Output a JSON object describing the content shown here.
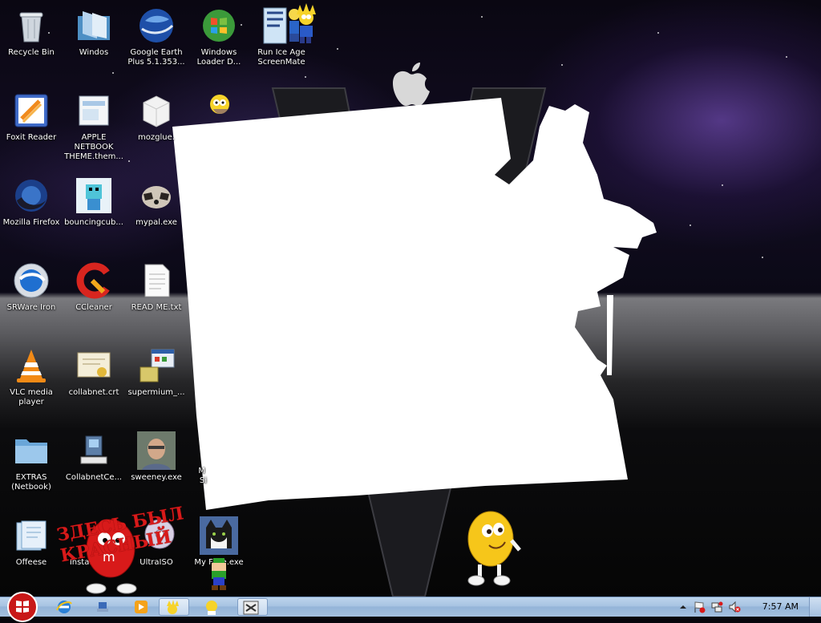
{
  "desktop": {
    "icons": [
      {
        "label": "Recycle Bin",
        "icon": "recycle-bin-icon"
      },
      {
        "label": "Windos",
        "icon": "folder-icon"
      },
      {
        "label": "Google Earth Plus 5.1.353...",
        "icon": "google-earth-icon"
      },
      {
        "label": "Windows Loader D...",
        "icon": "windows-loader-icon"
      },
      {
        "label": "Run Ice Age ScreenMate",
        "icon": "ice-age-icon"
      },
      {
        "label": "Foxit Reader",
        "icon": "foxit-reader-icon"
      },
      {
        "label": "APPLE NETBOOK THEME.them...",
        "icon": "theme-file-icon"
      },
      {
        "label": "mozglue.",
        "icon": "dll-file-icon"
      },
      {
        "label": "Mozilla Firefox",
        "icon": "firefox-icon"
      },
      {
        "label": "bouncingcub...",
        "icon": "bouncing-cube-icon"
      },
      {
        "label": "mypal.exe",
        "icon": "mypal-raccoon-icon"
      },
      {
        "label": "SRWare Iron",
        "icon": "srware-iron-icon"
      },
      {
        "label": "CCleaner",
        "icon": "ccleaner-icon"
      },
      {
        "label": "READ ME.txt",
        "icon": "text-file-icon"
      },
      {
        "label": "VLC media player",
        "icon": "vlc-cone-icon"
      },
      {
        "label": "collabnet.crt",
        "icon": "certificate-icon"
      },
      {
        "label": "supermium_...",
        "icon": "installer-icon"
      },
      {
        "label": "EXTRAS (Netbook)",
        "icon": "folder-icon"
      },
      {
        "label": "CollabnetCe...",
        "icon": "network-setup-icon"
      },
      {
        "label": "sweeney.exe",
        "icon": "photo-icon"
      },
      {
        "label": "Offeese",
        "icon": "folder-icon"
      },
      {
        "label": "Installer.exe",
        "icon": "installer-icon"
      },
      {
        "label": "UltraISO",
        "icon": "ultraiso-disc-icon"
      },
      {
        "label": "My Face.exe",
        "icon": "cat-face-icon"
      }
    ],
    "partial_labels": [
      "M",
      "Si"
    ],
    "graffiti_text": "ЗДЕСЬ БЫЛ КРАСНЫЙ"
  },
  "taskbar": {
    "clock": "7:57 AM",
    "pinned": [
      "internet-explorer-icon",
      "network-icon",
      "media-player-icon",
      "simpsons-icon",
      "simpsons-icon",
      "app-window-icon"
    ],
    "tray_icons": [
      "show-hidden-icons-chevron-icon",
      "flag-icon",
      "network-tray-icon",
      "volume-muted-icon"
    ]
  },
  "colors": {
    "taskbar": "#a8c4e2",
    "accent_red": "#d81a1a",
    "accent_yellow": "#f2c21a"
  }
}
